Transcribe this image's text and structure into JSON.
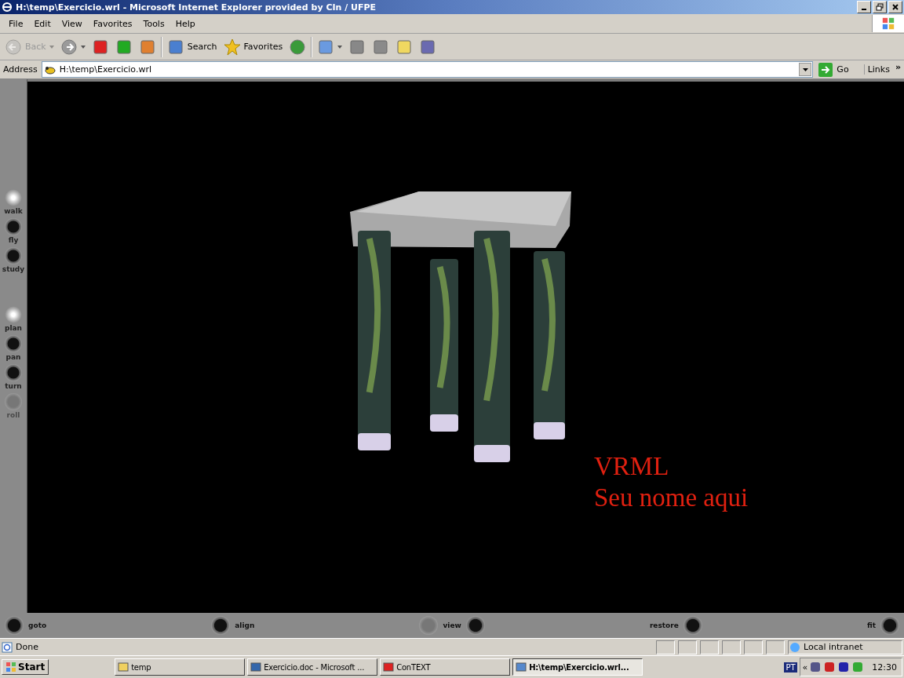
{
  "window": {
    "title": "H:\\temp\\Exercicio.wrl - Microsoft Internet Explorer provided by CIn / UFPE"
  },
  "menu": [
    "File",
    "Edit",
    "View",
    "Favorites",
    "Tools",
    "Help"
  ],
  "toolbar": [
    {
      "label": "Back",
      "disabled": true,
      "dropdown": true
    },
    {
      "disabled": false,
      "dropdown": true
    },
    {
      "disabled": false,
      "dropdown": false
    },
    {
      "disabled": false,
      "dropdown": false
    },
    {
      "disabled": false,
      "dropdown": false
    },
    {
      "label": "Search",
      "disabled": false,
      "dropdown": false
    },
    {
      "label": "Favorites",
      "disabled": false,
      "dropdown": false
    },
    {
      "disabled": false,
      "dropdown": false
    },
    {
      "disabled": false,
      "dropdown": true
    },
    {
      "disabled": false,
      "dropdown": false
    },
    {
      "disabled": false,
      "dropdown": false
    },
    {
      "disabled": false,
      "dropdown": false
    },
    {
      "disabled": false,
      "dropdown": false
    }
  ],
  "address": {
    "label": "Address",
    "value": "H:\\temp\\Exercicio.wrl",
    "go": "Go",
    "links": "Links",
    "more": "»"
  },
  "nav_modes": [
    {
      "label": "walk",
      "active": true,
      "disabled": false
    },
    {
      "label": "fly",
      "active": false,
      "disabled": false
    },
    {
      "label": "study",
      "active": false,
      "disabled": false
    },
    {
      "label": "plan",
      "active": true,
      "disabled": false
    },
    {
      "label": "pan",
      "active": false,
      "disabled": false
    },
    {
      "label": "turn",
      "active": false,
      "disabled": false
    },
    {
      "label": "roll",
      "active": false,
      "disabled": true
    }
  ],
  "scene_text": [
    "VRML",
    "Seu nome aqui"
  ],
  "bottom_controls": [
    "goto",
    "align",
    "view",
    "restore",
    "fit"
  ],
  "status_bar": {
    "text": "Done",
    "zone": "Local intranet"
  },
  "taskbar": {
    "start": "Start",
    "tasks": [
      {
        "label": "temp",
        "selected": false
      },
      {
        "label": "Exercicio.doc - Microsoft ...",
        "selected": false
      },
      {
        "label": "ConTEXT",
        "selected": false
      },
      {
        "label": "H:\\temp\\Exercicio.wrl...",
        "selected": true
      }
    ],
    "language": "PT",
    "expand": "«",
    "clock": "12:30"
  }
}
